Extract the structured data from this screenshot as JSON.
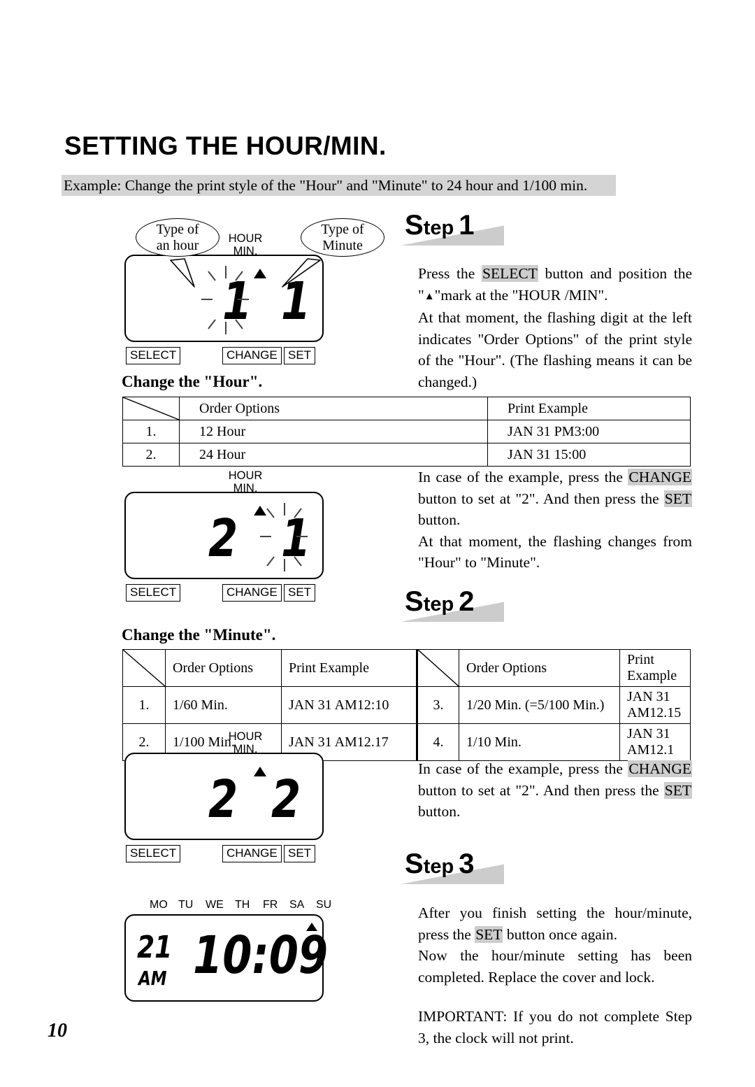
{
  "document": {
    "title": "SETTING THE HOUR/MIN.",
    "example_banner": "Example: Change the print style of the \"Hour\" and \"Minute\" to 24 hour and 1/100 min.",
    "page_number": "10"
  },
  "steps": [
    {
      "badge_s": "S",
      "badge_tep": "tep",
      "badge_num": "1",
      "paragraphs": [
        {
          "runs": [
            {
              "t": "Press the ",
              "hl": false
            },
            {
              "t": "SELECT",
              "hl": true
            },
            {
              "t": " button and position the \"",
              "hl": false
            },
            {
              "t": "▲",
              "hl": false
            },
            {
              "t": "\"mark at the \"HOUR /MIN\".",
              "hl": false
            }
          ]
        },
        {
          "runs": [
            {
              "t": "At that moment, the flashing digit at the left indicates \"Order Options\" of the print style of the \"Hour\". (The flashing means it can be changed.)",
              "hl": false
            }
          ]
        }
      ]
    },
    {
      "badge_s": "S",
      "badge_tep": "tep",
      "badge_num": "2",
      "paragraphs": [
        {
          "runs": [
            {
              "t": "In case of the example, press the ",
              "hl": false
            },
            {
              "t": "CHANGE",
              "hl": true
            },
            {
              "t": " button to set at \"2\". And then press the ",
              "hl": false
            },
            {
              "t": "SET",
              "hl": true
            },
            {
              "t": " button.",
              "hl": false
            }
          ]
        }
      ]
    },
    {
      "badge_s": "S",
      "badge_tep": "tep",
      "badge_num": "3",
      "paragraphs": [
        {
          "runs": [
            {
              "t": "After you finish setting the hour/minute, press the ",
              "hl": false
            },
            {
              "t": "SET",
              "hl": true
            },
            {
              "t": " button once again.",
              "hl": false
            }
          ]
        },
        {
          "runs": [
            {
              "t": "Now the hour/minute setting has been completed. Replace the cover and lock.",
              "hl": false
            }
          ]
        },
        {
          "runs": [
            {
              "t": "IMPORTANT: If you do not complete Step 3, the clock will not print.",
              "hl": false
            }
          ]
        }
      ]
    }
  ],
  "step1_extra_text": {
    "runs": [
      {
        "t": "In case of the example, press the ",
        "hl": false
      },
      {
        "t": "CHANGE",
        "hl": true
      },
      {
        "t": " button to set at \"2\". And then press the ",
        "hl": false
      },
      {
        "t": "SET",
        "hl": true
      },
      {
        "t": " button.",
        "hl": false
      }
    ]
  },
  "step1_extra_text2": {
    "runs": [
      {
        "t": "At that moment, the flashing changes from \"Hour\" to \"Minute\".",
        "hl": false
      }
    ]
  },
  "sections": {
    "hour_heading": "Change the \"Hour\".",
    "minute_heading": "Change the \"Minute\"."
  },
  "hour_table": {
    "headers": [
      "",
      "Order Options",
      "Print Example"
    ],
    "rows": [
      {
        "no": "1.",
        "option": "12 Hour",
        "example": "JAN 31 PM3:00"
      },
      {
        "no": "2.",
        "option": "24 Hour",
        "example": "JAN 31 15:00"
      }
    ]
  },
  "minute_table": {
    "headers": [
      "",
      "Order Options",
      "Print Example",
      "",
      "Order Options",
      "Print Example"
    ],
    "rows": [
      {
        "no_l": "1.",
        "option_l": "1/60 Min.",
        "example_l": "JAN 31 AM12:10",
        "no_r": "3.",
        "option_r": "1/20 Min. (=5/100 Min.)",
        "example_r": "JAN 31 AM12.15"
      },
      {
        "no_l": "2.",
        "option_l": "1/100 Min.",
        "example_l": "JAN 31 AM12.17",
        "no_r": "4.",
        "option_r": "1/10 Min.",
        "example_r": "JAN 31 AM12.1"
      }
    ]
  },
  "lcd_common": {
    "hour_label": "HOUR",
    "min_label": "MIN.",
    "buttons": [
      "SELECT",
      "CHANGE",
      "SET"
    ]
  },
  "lcd_displays": [
    {
      "id": "lcd-step1",
      "hour_digit": "1",
      "minute_digit": "1",
      "hour_flashing": true,
      "minute_flashing": false,
      "marker": "▲"
    },
    {
      "id": "lcd-hour-set",
      "hour_digit": "2",
      "minute_digit": "1",
      "hour_flashing": false,
      "minute_flashing": true,
      "marker": "▲"
    },
    {
      "id": "lcd-minute-set",
      "hour_digit": "2",
      "minute_digit": "2",
      "hour_flashing": false,
      "minute_flashing": false,
      "marker": "▲"
    }
  ],
  "lcd_clock": {
    "id": "lcd-clock",
    "days": [
      "MO",
      "TU",
      "WE",
      "TH",
      "FR",
      "SA",
      "SU"
    ],
    "date": "21",
    "meridiem": "AM",
    "time": "10:09",
    "marker": "▲"
  },
  "callouts": [
    {
      "line1": "Type of",
      "line2": "an hour"
    },
    {
      "line1": "Type of",
      "line2": "Minute"
    }
  ]
}
